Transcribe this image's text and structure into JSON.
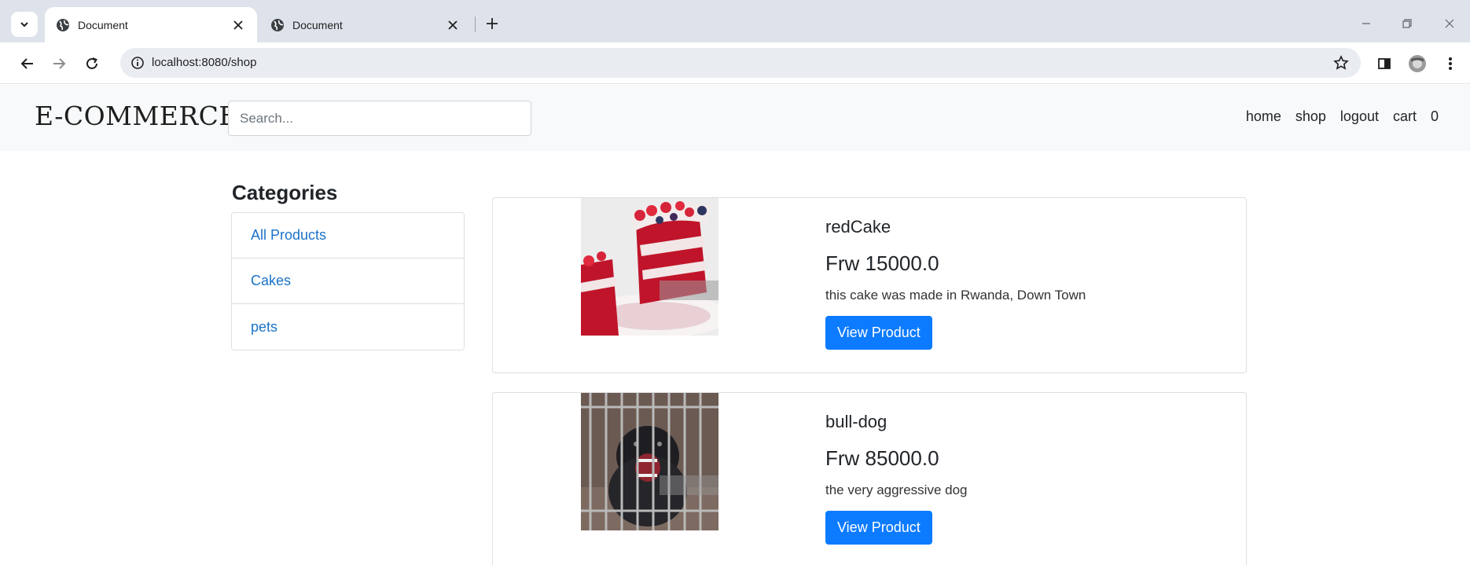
{
  "browser": {
    "tabs": [
      {
        "title": "Document",
        "active": true
      },
      {
        "title": "Document",
        "active": false
      }
    ],
    "url": "localhost:8080/shop"
  },
  "navbar": {
    "brand": "E-COMMERCE",
    "search_placeholder": "Search...",
    "links": {
      "home": "home",
      "shop": "shop",
      "logout": "logout",
      "cart": "cart",
      "cart_count": "0"
    }
  },
  "sidebar": {
    "title": "Categories",
    "items": [
      {
        "label": "All Products"
      },
      {
        "label": "Cakes"
      },
      {
        "label": "pets"
      }
    ]
  },
  "products": [
    {
      "name": "redCake",
      "price": "Frw 15000.0",
      "description": "this cake was made in Rwanda, Down Town",
      "button": "View Product"
    },
    {
      "name": "bull-dog",
      "price": "Frw 85000.0",
      "description": "the very aggressive dog",
      "button": "View Product"
    }
  ],
  "colors": {
    "accent": "#0d7bff",
    "link": "#1a73c8",
    "navbar_bg": "#f8f9fa",
    "tabstrip_bg": "#dee3eb"
  }
}
